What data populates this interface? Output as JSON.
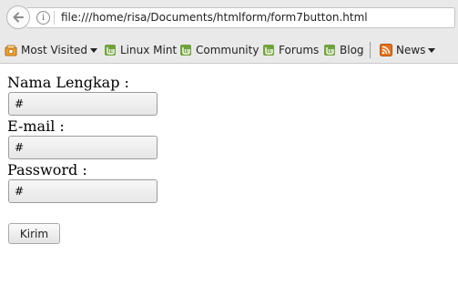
{
  "browser": {
    "url": "file:///home/risa/Documents/htmlform/form7button.html"
  },
  "bookmarks": [
    {
      "label": "Most Visited",
      "icon": "most-visited-icon",
      "dropdown": true
    },
    {
      "label": "Linux Mint",
      "icon": "mint-icon",
      "dropdown": false
    },
    {
      "label": "Community",
      "icon": "mint-icon",
      "dropdown": false
    },
    {
      "label": "Forums",
      "icon": "mint-icon",
      "dropdown": false
    },
    {
      "label": "Blog",
      "icon": "mint-icon",
      "dropdown": false
    },
    {
      "label": "News",
      "icon": "rss-icon",
      "dropdown": true
    }
  ],
  "form": {
    "name_label": "Nama Lengkap :",
    "name_value": "#",
    "email_label": "E-mail :",
    "email_value": "#",
    "password_label": "Password :",
    "password_value": "#",
    "submit_label": "Kirim"
  },
  "colors": {
    "mint_green": "#71a33d",
    "rss_orange": "#e8731d",
    "toolbar_bg": "#e9e9e9"
  }
}
